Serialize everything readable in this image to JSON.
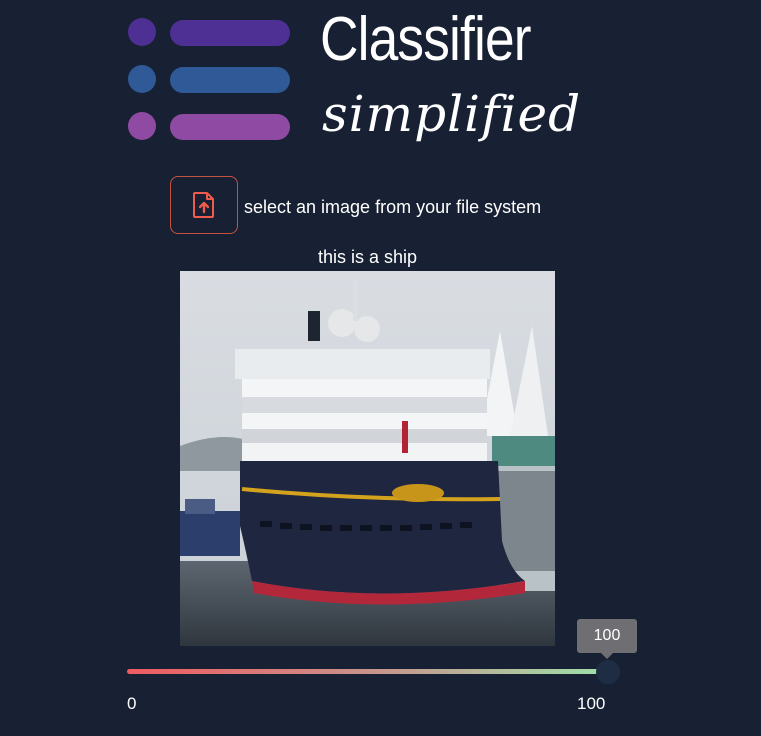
{
  "logo": {
    "title": "Classifier",
    "subtitle": "simplified",
    "dot_colors": [
      "#4e2f94",
      "#2f5a97",
      "#8f4aa3"
    ],
    "bar_colors": [
      "#4e2f94",
      "#2f5a97",
      "#8f4aa3"
    ]
  },
  "upload": {
    "icon": "file-upload-icon",
    "label": "select an image from your file system",
    "accent": "#ef5b4c"
  },
  "result": {
    "text": "this is a ship"
  },
  "slider": {
    "value": "100",
    "min": "0",
    "max": "100",
    "fraction": 1.0
  }
}
